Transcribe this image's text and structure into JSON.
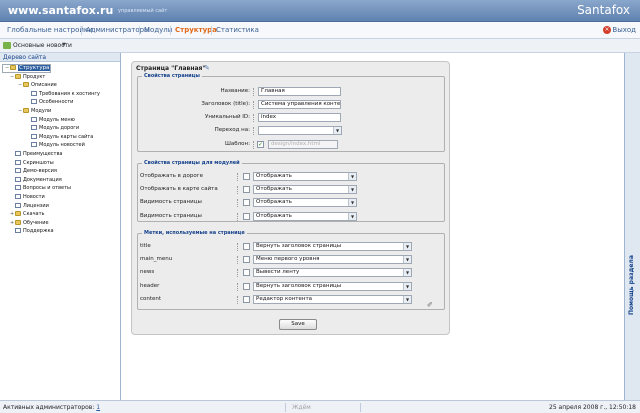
{
  "header": {
    "site_url": "www.santafox.ru",
    "site_tagline": "управляемый сайт",
    "brand": "Santafox"
  },
  "menu": {
    "items": [
      {
        "label": "Глобальные настройки",
        "active": false
      },
      {
        "label": "Администраторы",
        "active": false
      },
      {
        "label": "Модули",
        "active": false
      },
      {
        "label": "Структура",
        "active": true
      },
      {
        "label": "Статистика",
        "active": false
      }
    ],
    "logout": "Выход"
  },
  "subbar": {
    "label": "Основные новости"
  },
  "tree": {
    "title": "Дерево сайта",
    "nodes": [
      {
        "label": "Структура",
        "type": "folder",
        "level": 0,
        "selected": true,
        "toggle": "−"
      },
      {
        "label": "Продукт",
        "type": "folder",
        "level": 1,
        "toggle": "−"
      },
      {
        "label": "Описание",
        "type": "folder",
        "level": 2,
        "toggle": "−"
      },
      {
        "label": "Требования к хостингу",
        "type": "doc",
        "level": 3
      },
      {
        "label": "Особенности",
        "type": "doc",
        "level": 3
      },
      {
        "label": "Модули",
        "type": "folder",
        "level": 2,
        "toggle": "−"
      },
      {
        "label": "Модуль меню",
        "type": "doc",
        "level": 3
      },
      {
        "label": "Модуль дороги",
        "type": "doc",
        "level": 3
      },
      {
        "label": "Модуль карты сайта",
        "type": "doc",
        "level": 3
      },
      {
        "label": "Модуль новостей",
        "type": "doc",
        "level": 3
      },
      {
        "label": "Преимущества",
        "type": "doc",
        "level": 1
      },
      {
        "label": "Скриншоты",
        "type": "doc",
        "level": 1
      },
      {
        "label": "Демо-версия",
        "type": "doc",
        "level": 1
      },
      {
        "label": "Документация",
        "type": "doc",
        "level": 1
      },
      {
        "label": "Вопросы и ответы",
        "type": "doc",
        "level": 1
      },
      {
        "label": "Новости",
        "type": "doc",
        "level": 1
      },
      {
        "label": "Лицензии",
        "type": "doc",
        "level": 1
      },
      {
        "label": "Скачать",
        "type": "folder",
        "level": 1,
        "toggle": "+"
      },
      {
        "label": "Обучение",
        "type": "folder",
        "level": 1,
        "toggle": "+"
      },
      {
        "label": "Поддержка",
        "type": "doc",
        "level": 1
      }
    ]
  },
  "panel": {
    "title": "Страница \"Главная\"",
    "props": {
      "legend": "Свойства страницы",
      "name_label": "Название:",
      "name_value": "Главная",
      "title_label": "Заголовок (title):",
      "title_value": "Система управления контенто",
      "id_label": "Уникальный ID:",
      "id_value": "index",
      "goto_label": "Переход на:",
      "goto_value": "",
      "template_label": "Шаблон:",
      "template_value": "design/index.html"
    },
    "modules": {
      "legend": "Свойства страницы для модулей",
      "rows": [
        {
          "label": "Отображать в дороге",
          "value": "Отображать"
        },
        {
          "label": "Отображать в карте сайта",
          "value": "Отображать"
        },
        {
          "label": "Видимость страницы",
          "value": "Отображать"
        },
        {
          "label": "Видимость страницы",
          "value": "Отображать"
        }
      ]
    },
    "labels": {
      "legend": "Метки, используемые на странице",
      "rows": [
        {
          "label": "title",
          "value": "Вернуть заголовок страницы"
        },
        {
          "label": "main_menu",
          "value": "Меню первого уровня"
        },
        {
          "label": "news",
          "value": "Вывести ленту"
        },
        {
          "label": "header",
          "value": "Вернуть заголовок страницы"
        },
        {
          "label": "content",
          "value": "Редактор контента"
        }
      ]
    },
    "save_label": "Save"
  },
  "help": {
    "label": "Помощь раздела"
  },
  "status": {
    "admins_label": "Активных администраторов:",
    "admins_count": "1",
    "mid": "Ждём",
    "datetime": "25 апреля 2008 г., 12:50:18"
  }
}
